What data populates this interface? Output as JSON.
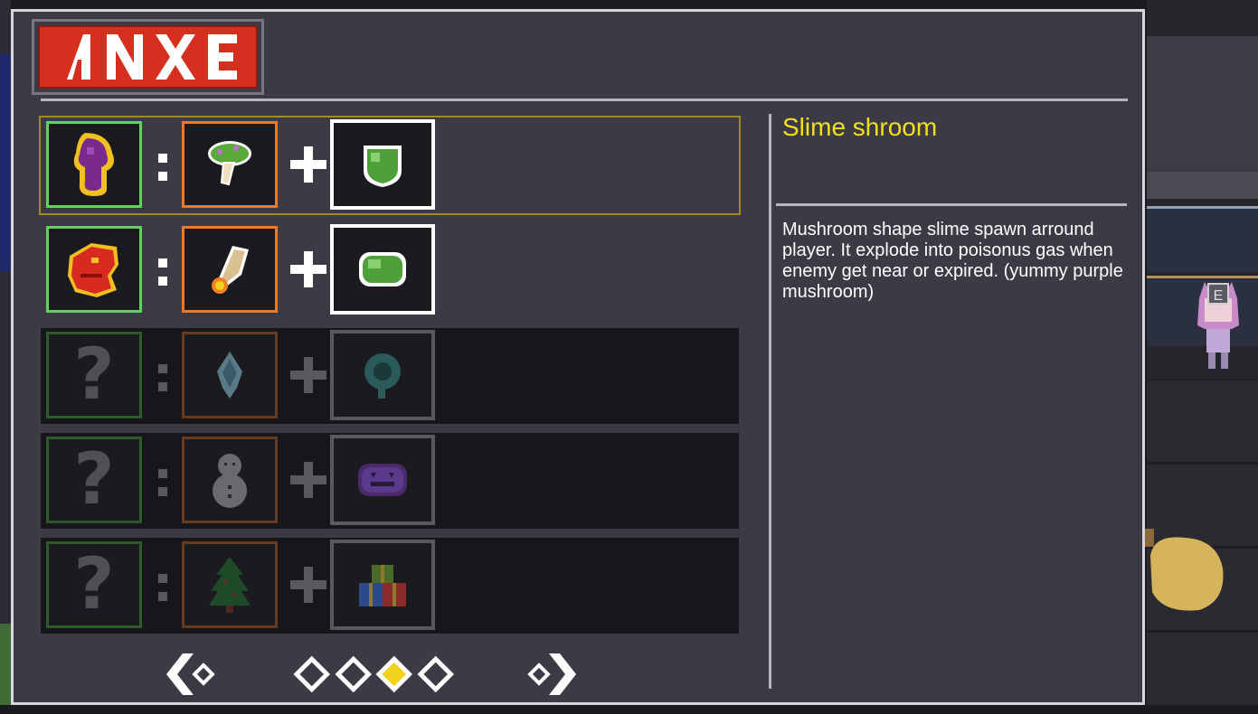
{
  "panel": {
    "logo_text": "ANXE"
  },
  "recipes": [
    {
      "result_icon": "purple-mushroom-icon",
      "ingredient1_icon": "green-mushroom-icon",
      "ingredient2_icon": "green-slime-shield-icon",
      "locked": false,
      "selected": true
    },
    {
      "result_icon": "red-dragon-icon",
      "ingredient1_icon": "fire-scroll-icon",
      "ingredient2_icon": "green-slime-barrel-icon",
      "locked": false,
      "selected": false
    },
    {
      "result_label": "?",
      "ingredient1_icon": "ice-crystal-icon",
      "ingredient2_icon": "teal-orb-icon",
      "locked": true
    },
    {
      "result_label": "?",
      "ingredient1_icon": "snowman-icon",
      "ingredient2_icon": "purple-pumpkin-icon",
      "locked": true
    },
    {
      "result_label": "?",
      "ingredient1_icon": "christmas-tree-icon",
      "ingredient2_icon": "gift-boxes-icon",
      "locked": true
    }
  ],
  "detail": {
    "title": "Slime shroom",
    "description": "Mushroom shape slime spawn arround player. It explode into poisonus gas when enemy get near or expired. (yummy purple mushroom)"
  },
  "pagination": {
    "pages": 4,
    "current": 3,
    "prev_icon": "chevron-left-icon",
    "next_icon": "chevron-right-icon"
  },
  "colors": {
    "panel_bg": "#3c3a44",
    "result_border": "#5fd45c",
    "ingredient_border": "#ee7a28",
    "title_color": "#f2e01a",
    "logo_red": "#d5301f",
    "active_dot": "#f2d21a"
  }
}
